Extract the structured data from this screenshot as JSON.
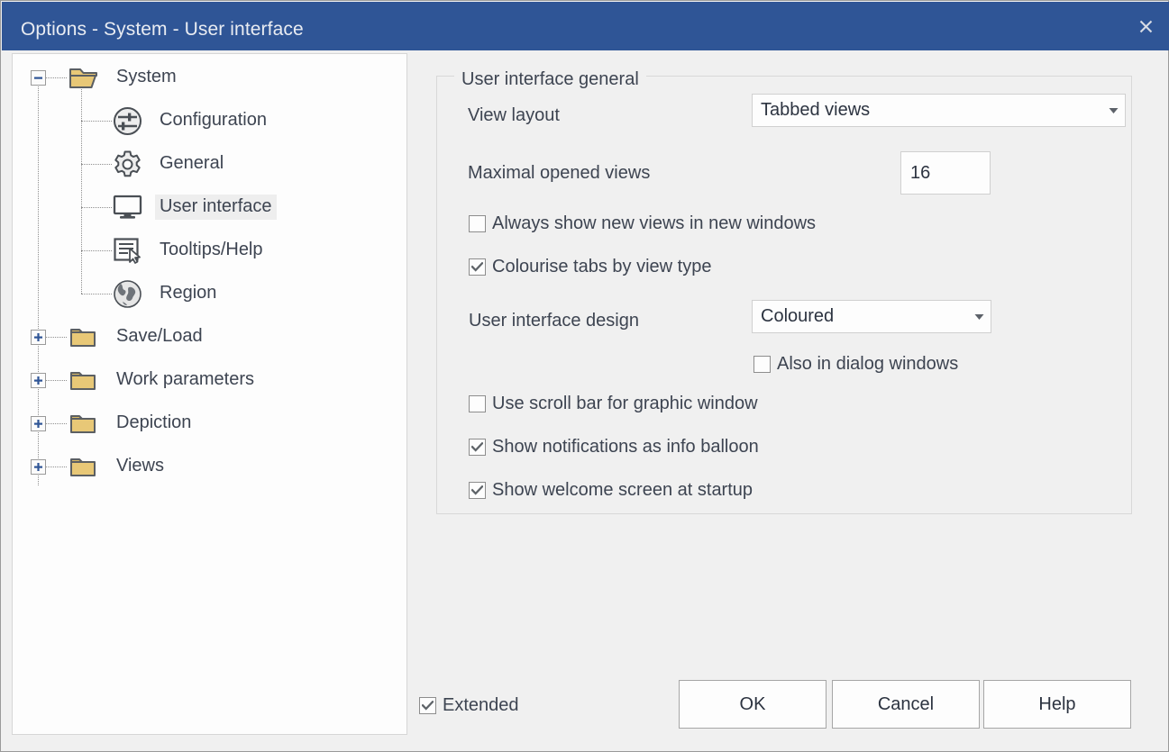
{
  "window": {
    "title": "Options - System - User interface",
    "close_icon": "close-icon",
    "accent_color": "#2f5596",
    "background_color": "#f0f0f0"
  },
  "tree": {
    "nodes": [
      {
        "label": "System",
        "icon": "folder-open-icon",
        "expander": "minus",
        "level": 0,
        "selected": false
      },
      {
        "label": "Configuration",
        "icon": "sliders-icon",
        "expander": "none",
        "level": 1,
        "selected": false
      },
      {
        "label": "General",
        "icon": "gear-icon",
        "expander": "none",
        "level": 1,
        "selected": false
      },
      {
        "label": "User interface",
        "icon": "monitor-icon",
        "expander": "none",
        "level": 1,
        "selected": true
      },
      {
        "label": "Tooltips/Help",
        "icon": "tooltip-icon",
        "expander": "none",
        "level": 1,
        "selected": false
      },
      {
        "label": "Region",
        "icon": "globe-icon",
        "expander": "none",
        "level": 1,
        "selected": false
      },
      {
        "label": "Save/Load",
        "icon": "folder-icon",
        "expander": "plus",
        "level": 0,
        "selected": false
      },
      {
        "label": "Work parameters",
        "icon": "folder-icon",
        "expander": "plus",
        "level": 0,
        "selected": false
      },
      {
        "label": "Depiction",
        "icon": "folder-icon",
        "expander": "plus",
        "level": 0,
        "selected": false
      },
      {
        "label": "Views",
        "icon": "folder-icon",
        "expander": "plus",
        "level": 0,
        "selected": false
      }
    ]
  },
  "panel": {
    "group_title": "User interface general",
    "view_layout": {
      "label": "View layout",
      "value": "Tabbed views",
      "options": [
        "Tabbed views"
      ]
    },
    "maximal_opened_views": {
      "label": "Maximal opened views",
      "value": "16"
    },
    "always_new_windows": {
      "label": "Always show new views in new windows",
      "checked": false
    },
    "colourise_tabs": {
      "label": "Colourise tabs by view type",
      "checked": true
    },
    "ui_design": {
      "label": "User interface design",
      "value": "Coloured",
      "options": [
        "Coloured"
      ]
    },
    "also_dialog_windows": {
      "label": "Also in dialog windows",
      "checked": false
    },
    "use_scroll_bar": {
      "label": "Use scroll bar for graphic window",
      "checked": false
    },
    "show_notifications": {
      "label": "Show notifications as info balloon",
      "checked": true
    },
    "show_welcome": {
      "label": "Show welcome screen at startup",
      "checked": true
    }
  },
  "footer": {
    "extended": {
      "label": "Extended",
      "checked": true
    },
    "ok_label": "OK",
    "cancel_label": "Cancel",
    "help_label": "Help"
  }
}
